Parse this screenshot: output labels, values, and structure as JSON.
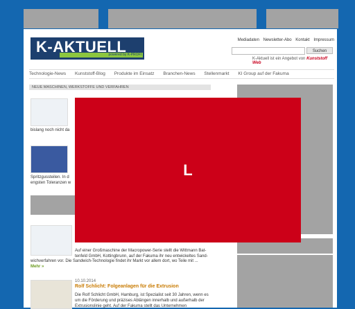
{
  "logo": {
    "title": "K-AKTUELL",
    "subtitle": "powered by K-PROFI"
  },
  "toplinks": [
    "Mediadaten",
    "Newsletter-Abo",
    "Kontakt",
    "Impressum"
  ],
  "search": {
    "button": "Suchen"
  },
  "tagline": {
    "text": "K-Aktuell ist ein Angebot von",
    "brand": "Kunststoff Web"
  },
  "nav": [
    "Technologie-News",
    "Kunststoff-Blog",
    "Produkte im Einsatz",
    "Branchen-News",
    "Stellenmarkt",
    "KI Group auf der Fakuma"
  ],
  "section": {
    "title": "NEUE MASCHINEN, WERKSTOFFE UND VERFAHREN"
  },
  "articles": [
    {
      "snippet": "bislang noch nicht da"
    },
    {
      "snippet1": "Spritzgussteilen. In d",
      "snippet2": "engsten Toleranzen w"
    },
    {
      "body1": "Auf einer Großmaschine der Macropower-Serie stellt die Wittmann Bat-",
      "body2": "tenfeld GmbH, Kottingbrunn, auf der Fakuma ihr neu entwickeltes Sand-",
      "body3": "wichverfahren vor. Die Sandwich-Technologie findet ihr Markt vor allem dort, wo Teile mit ...",
      "more": "Mehr »"
    },
    {
      "date": "10.10.2014",
      "headline": "Rolf Schlicht: Folgeanlagen für die Extrusion",
      "body1": "Die Rolf Schlicht GmbH, Hamburg, ist Spezialist seit 30 Jahren, wenn es",
      "body2": "um die Förderung und präzises Ablängen innerhalb und außerhalb der",
      "body3": "Extrusionslinie geht. Auf der Fakuma stellt das Unternehmen",
      "more": "Mehr »"
    }
  ],
  "overlay": {
    "text": "L"
  },
  "colors": {
    "frame": "#1467b0",
    "overlay": "#cc0018",
    "ad": "#a3a3a3",
    "brand": "#1d3f6e"
  }
}
